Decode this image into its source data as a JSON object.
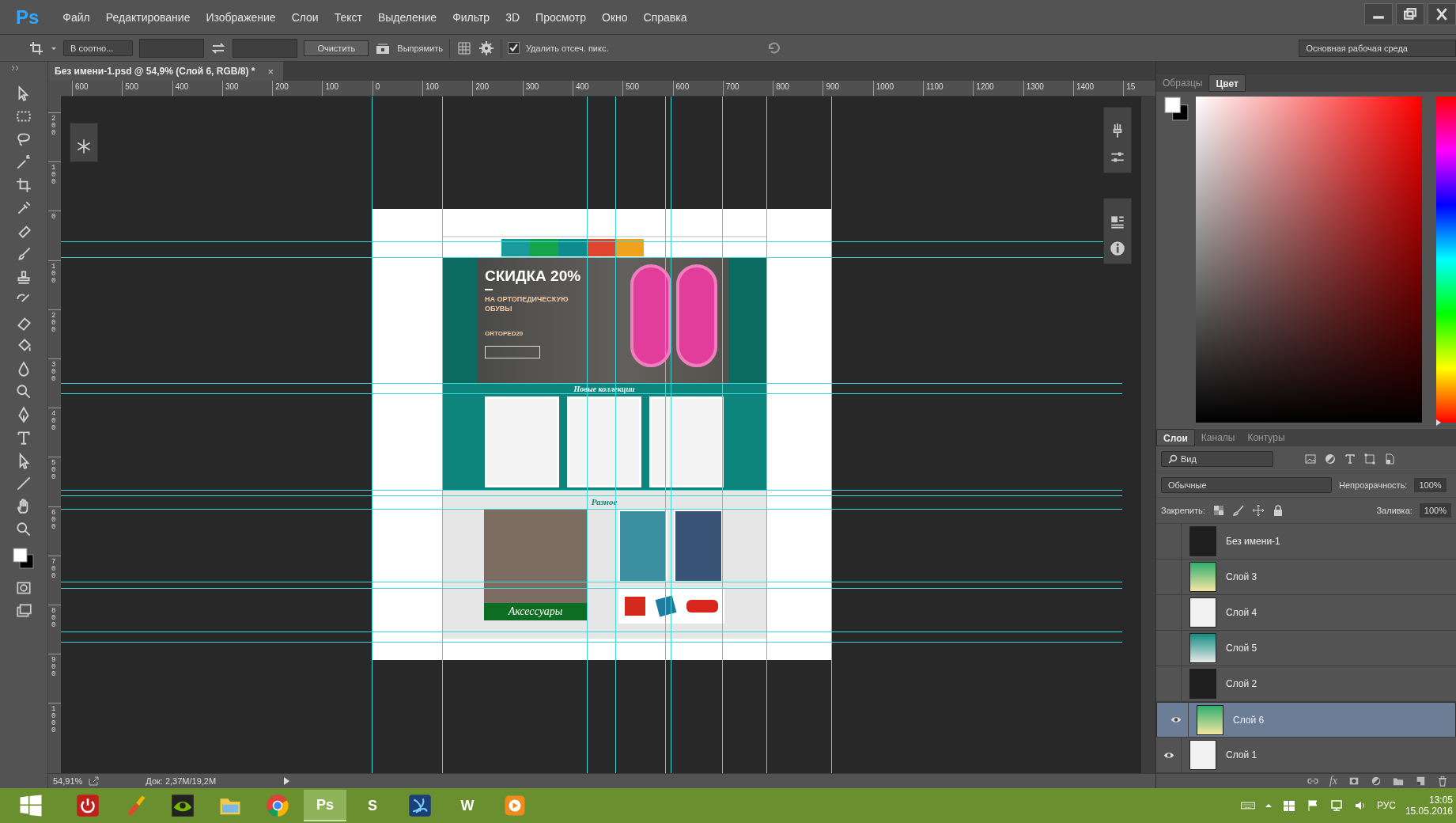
{
  "app_logo": "Ps",
  "menu": [
    "Файл",
    "Редактирование",
    "Изображение",
    "Слои",
    "Текст",
    "Выделение",
    "Фильтр",
    "3D",
    "Просмотр",
    "Окно",
    "Справка"
  ],
  "options_bar": {
    "ratio_select": "В соотно...",
    "clear_button": "Очистить",
    "straighten_button": "Выпрямить",
    "delete_cropped": {
      "label": "Удалить отсеч. пикс.",
      "checked": true
    },
    "workspace": "Основная рабочая среда"
  },
  "document_tab": {
    "title": "Без имени-1.psd @ 54,9% (Слой 6, RGB/8) *",
    "close": "×"
  },
  "ruler": {
    "horizontal": [
      "600",
      "500",
      "400",
      "300",
      "200",
      "100",
      "0",
      "100",
      "200",
      "300",
      "400",
      "500",
      "600",
      "700",
      "800",
      "900",
      "1000",
      "1100",
      "1200",
      "1300",
      "1400",
      "15"
    ],
    "vertical": [
      "200",
      "100",
      "0",
      "100",
      "200",
      "300",
      "400",
      "500",
      "600",
      "700",
      "800",
      "900",
      "1000"
    ]
  },
  "design": {
    "nav_tabs": [
      {
        "color": "#1a9a9a"
      },
      {
        "color": "#16a34a"
      },
      {
        "color": "#0f8b8d"
      },
      {
        "color": "#e0452f"
      },
      {
        "color": "#f0a21a"
      }
    ],
    "banner": {
      "title": "СКИДКА 20%",
      "subtitle": "НА ОРТОПЕДИЧЕСКУЮ ОБУВЬ!",
      "promo_code": "ORTOPED20"
    },
    "collections_title": "Новые коллекции",
    "misc_title": "Разное",
    "accessories_label": "Аксессуары"
  },
  "status_bar": {
    "zoom": "54,91%",
    "doc_size": "Док: 2,37M/19,2M"
  },
  "color_panel": {
    "tabs": [
      {
        "label": "Образцы",
        "selected": false
      },
      {
        "label": "Цвет",
        "selected": true
      }
    ],
    "hue": {
      "level": 0
    }
  },
  "layers_panel": {
    "tabs": [
      {
        "label": "Слои",
        "selected": true
      },
      {
        "label": "Каналы",
        "selected": false
      },
      {
        "label": "Контуры",
        "selected": false
      }
    ],
    "filter": "Вид",
    "blend_mode": "Обычные",
    "opacity_label": "Непрозрачность:",
    "opacity": "100%",
    "lock_label": "Закрепить:",
    "fill_label": "Заливка:",
    "fill": "100%",
    "items": [
      {
        "name": "Без имени-1",
        "visible": false,
        "selected": false
      },
      {
        "name": "Слой 3",
        "visible": false,
        "selected": false
      },
      {
        "name": "Слой 4",
        "visible": false,
        "selected": false
      },
      {
        "name": "Слой 5",
        "visible": false,
        "selected": false
      },
      {
        "name": "Слой 2",
        "visible": false,
        "selected": false
      },
      {
        "name": "Слой 6",
        "visible": true,
        "selected": true
      },
      {
        "name": "Слой 1",
        "visible": true,
        "selected": false
      }
    ],
    "footer_fx": "fx"
  },
  "taskbar": {
    "apps": [
      {
        "kind": "power"
      },
      {
        "kind": "cleaner"
      },
      {
        "kind": "nvidia"
      },
      {
        "kind": "folder"
      },
      {
        "kind": "chrome"
      },
      {
        "kind": "letter",
        "label": "Ps",
        "selected": true
      },
      {
        "kind": "letter",
        "label": "S",
        "selected": false
      },
      {
        "kind": "swirl"
      },
      {
        "kind": "letter",
        "label": "W",
        "selected": false
      },
      {
        "kind": "player"
      }
    ],
    "language": "РУС",
    "time": "13:05",
    "date": "15.05.2016"
  }
}
